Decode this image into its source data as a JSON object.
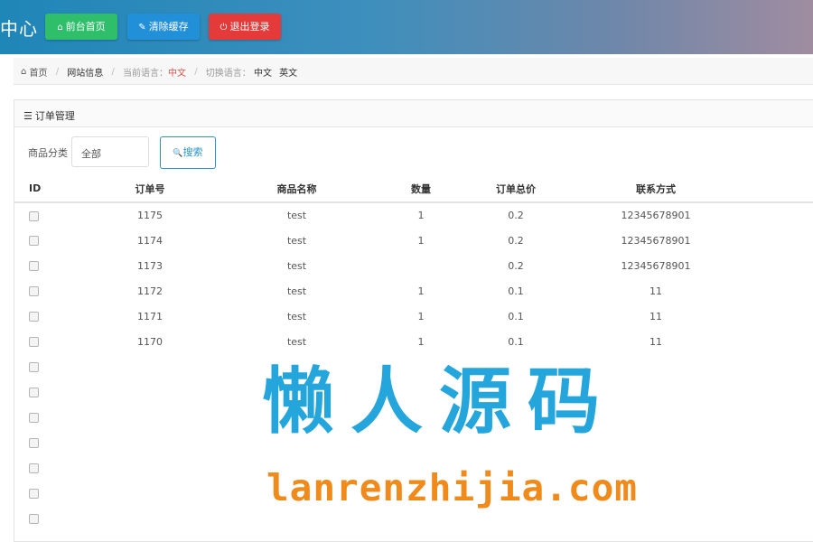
{
  "header": {
    "brand": "中心",
    "buttons": [
      {
        "icon": "home-icon",
        "glyph": "⌂",
        "label": "前台首页",
        "color": "#2fbf6b"
      },
      {
        "icon": "wrench-icon",
        "glyph": "✎",
        "label": "清除缓存",
        "color": "#2290d8"
      },
      {
        "icon": "power-icon",
        "glyph": "⏻",
        "label": "退出登录",
        "color": "#e43a3a"
      }
    ]
  },
  "breadcrumb": {
    "home_glyph": "⌂",
    "home": "首页",
    "site_info": "网站信息",
    "current_lang_label": "当前语言：",
    "current_lang_value": "中文",
    "switch_label": "切换语言：",
    "lang_cn": "中文",
    "lang_en": "英文"
  },
  "panel": {
    "glyph": "☰",
    "title": "订单管理"
  },
  "filter": {
    "label": "商品分类",
    "selected": "全部",
    "search_glyph": "🔍",
    "search_label": "搜索"
  },
  "table": {
    "headers": [
      "ID",
      "订单号",
      "商品名称",
      "数量",
      "订单总价",
      "联系方式"
    ],
    "rows": [
      {
        "order": "1175",
        "name": "test",
        "qty": "1",
        "total": "0.2",
        "contact": "12345678901"
      },
      {
        "order": "1174",
        "name": "test",
        "qty": "1",
        "total": "0.2",
        "contact": "12345678901"
      },
      {
        "order": "1173",
        "name": "test",
        "qty": "",
        "total": "0.2",
        "contact": "12345678901"
      },
      {
        "order": "1172",
        "name": "test",
        "qty": "1",
        "total": "0.1",
        "contact": "11"
      },
      {
        "order": "1171",
        "name": "test",
        "qty": "1",
        "total": "0.1",
        "contact": "11"
      },
      {
        "order": "1170",
        "name": "test",
        "qty": "1",
        "total": "0.1",
        "contact": "11"
      },
      {
        "order": "",
        "name": "",
        "qty": "",
        "total": "",
        "contact": ""
      },
      {
        "order": "",
        "name": "",
        "qty": "",
        "total": "",
        "contact": ""
      },
      {
        "order": "",
        "name": "",
        "qty": "",
        "total": "",
        "contact": ""
      },
      {
        "order": "",
        "name": "",
        "qty": "",
        "total": "",
        "contact": ""
      },
      {
        "order": "",
        "name": "",
        "qty": "",
        "total": "",
        "contact": ""
      },
      {
        "order": "",
        "name": "",
        "qty": "",
        "total": "",
        "contact": ""
      },
      {
        "order": "",
        "name": "",
        "qty": "",
        "total": "",
        "contact": ""
      }
    ]
  },
  "watermark": {
    "cn": "懒人源码",
    "en": "lanrenzhijia.com"
  }
}
